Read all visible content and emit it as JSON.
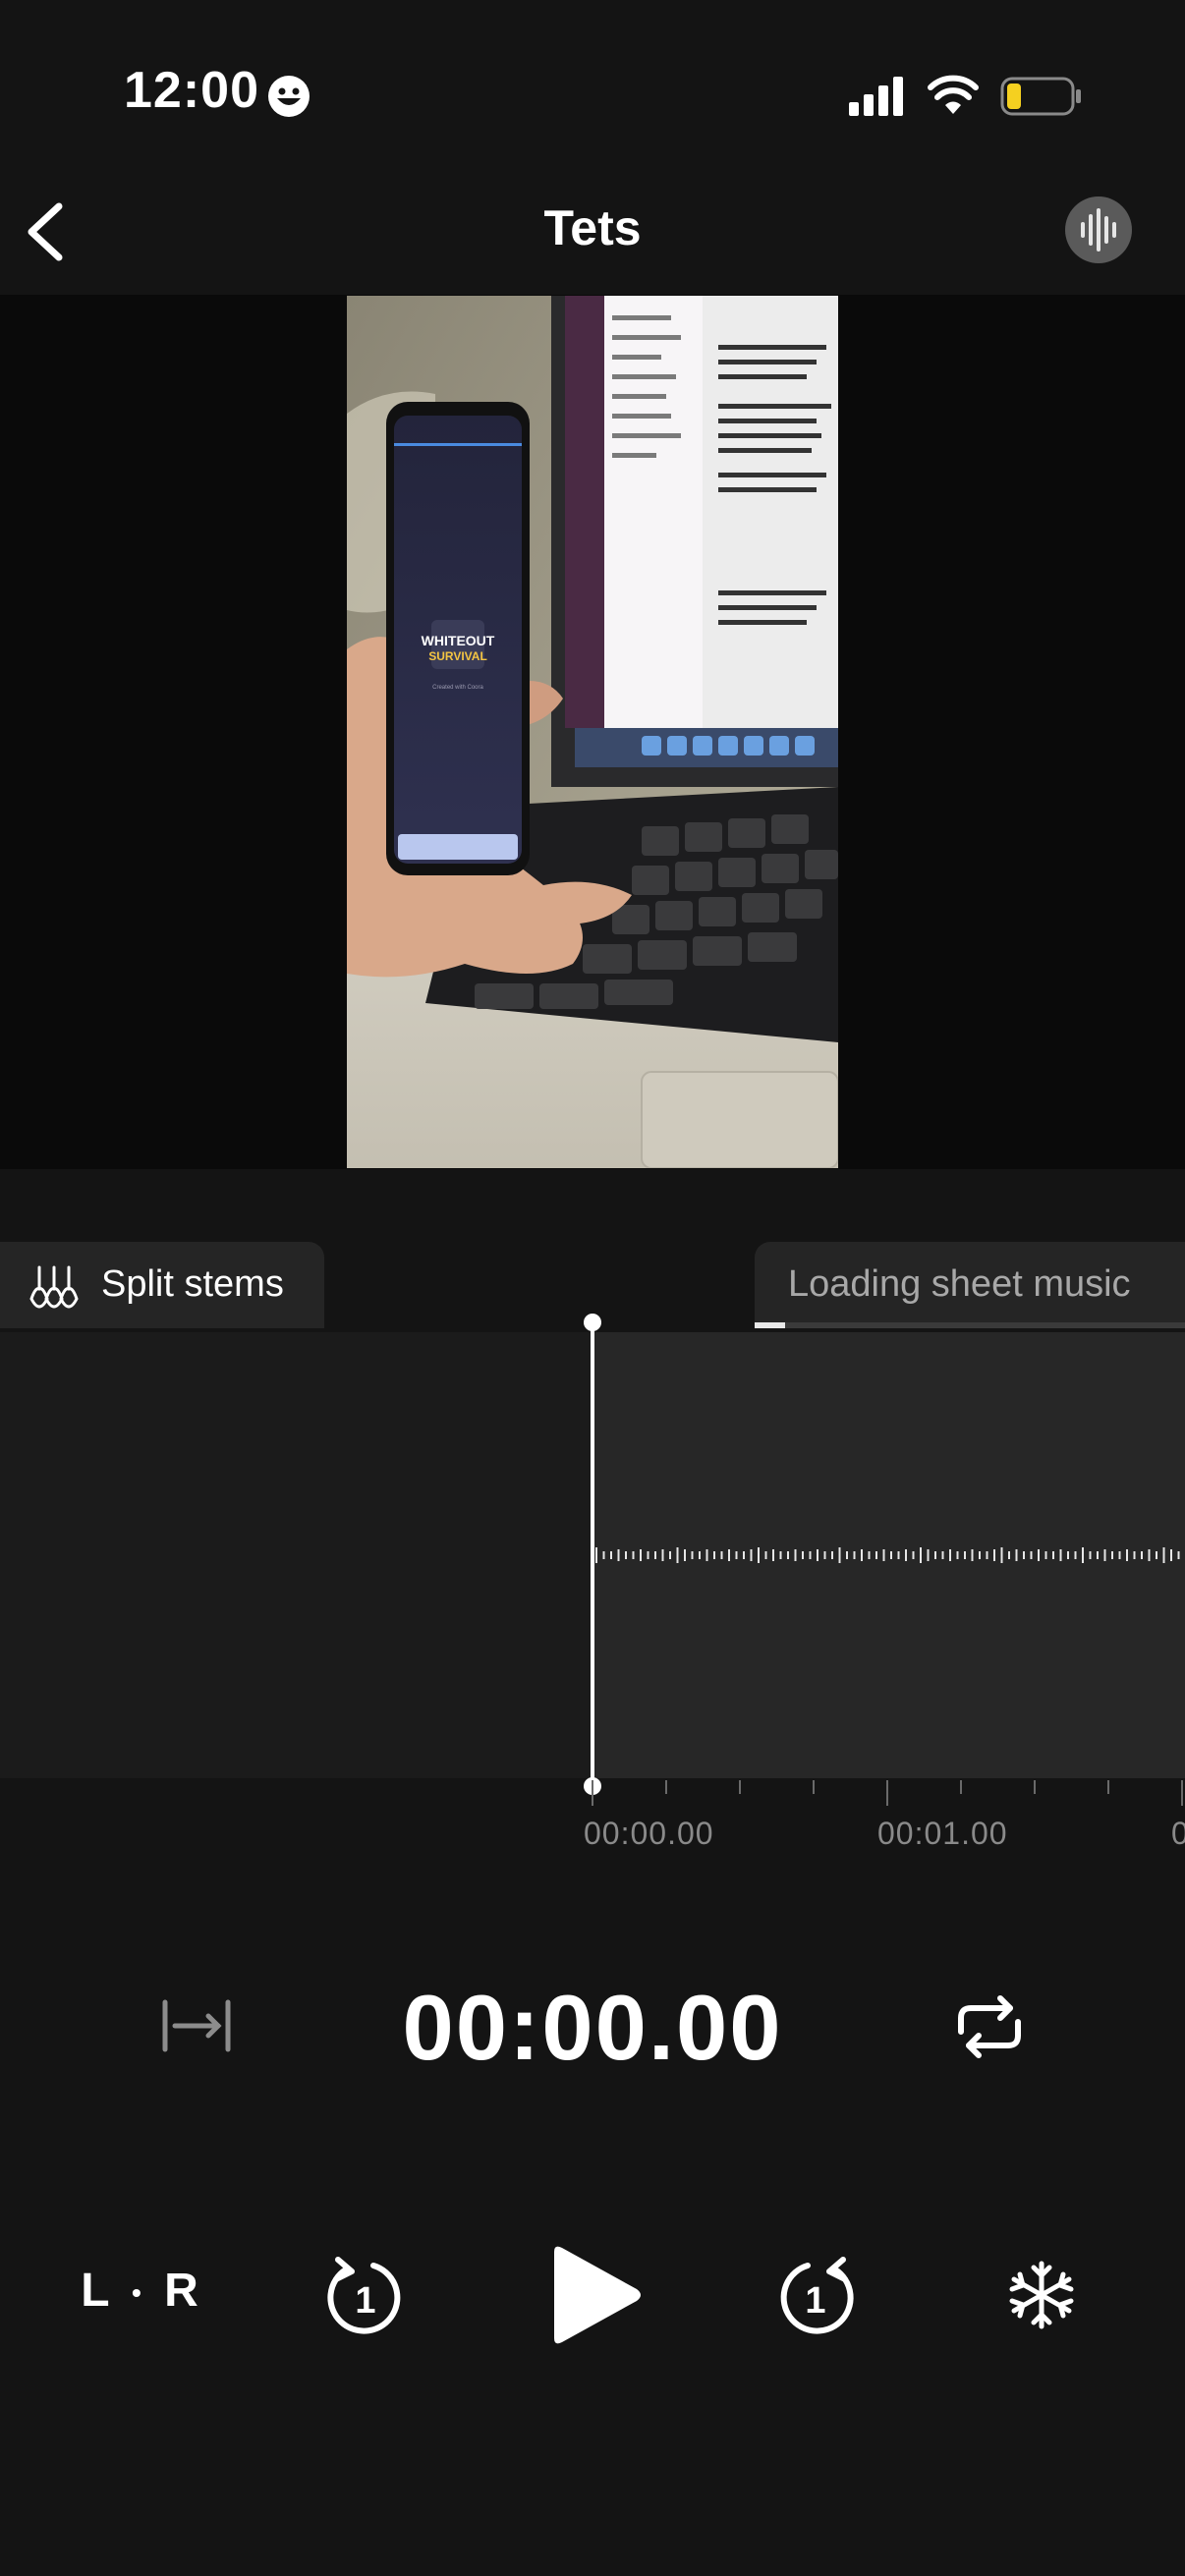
{
  "status_bar": {
    "time": "12:00",
    "emoji_icon": "smiley-face-icon",
    "icons": [
      "cellular-signal-icon",
      "wifi-icon",
      "battery-low-icon"
    ]
  },
  "nav": {
    "back_icon": "chevron-left-icon",
    "title": "Tets",
    "audio_icon": "sound-wave-icon"
  },
  "video": {
    "screen_text_1": "WHITEOUT",
    "screen_text_2": "SURVIVAL",
    "screen_caption": "Created with Coora"
  },
  "stems": {
    "label": "Split stems",
    "icon": "guitars-icon"
  },
  "sheet_music": {
    "label": "Loading sheet music",
    "progress": 0.07
  },
  "timeline": {
    "time_labels": [
      "00:00.00",
      "00:01.00",
      "0"
    ]
  },
  "transport": {
    "current_time": "00:00.00",
    "fit_icon": "fit-width-icon",
    "loop_icon": "loop-icon"
  },
  "controls": {
    "lr_label_left": "L",
    "lr_label_right": "R",
    "rewind_seconds": "1",
    "forward_seconds": "1",
    "play_icon": "play-icon",
    "freeze_icon": "snowflake-icon"
  },
  "colors": {
    "background": "#141414",
    "panel": "#252525",
    "accent": "#ffffff"
  }
}
